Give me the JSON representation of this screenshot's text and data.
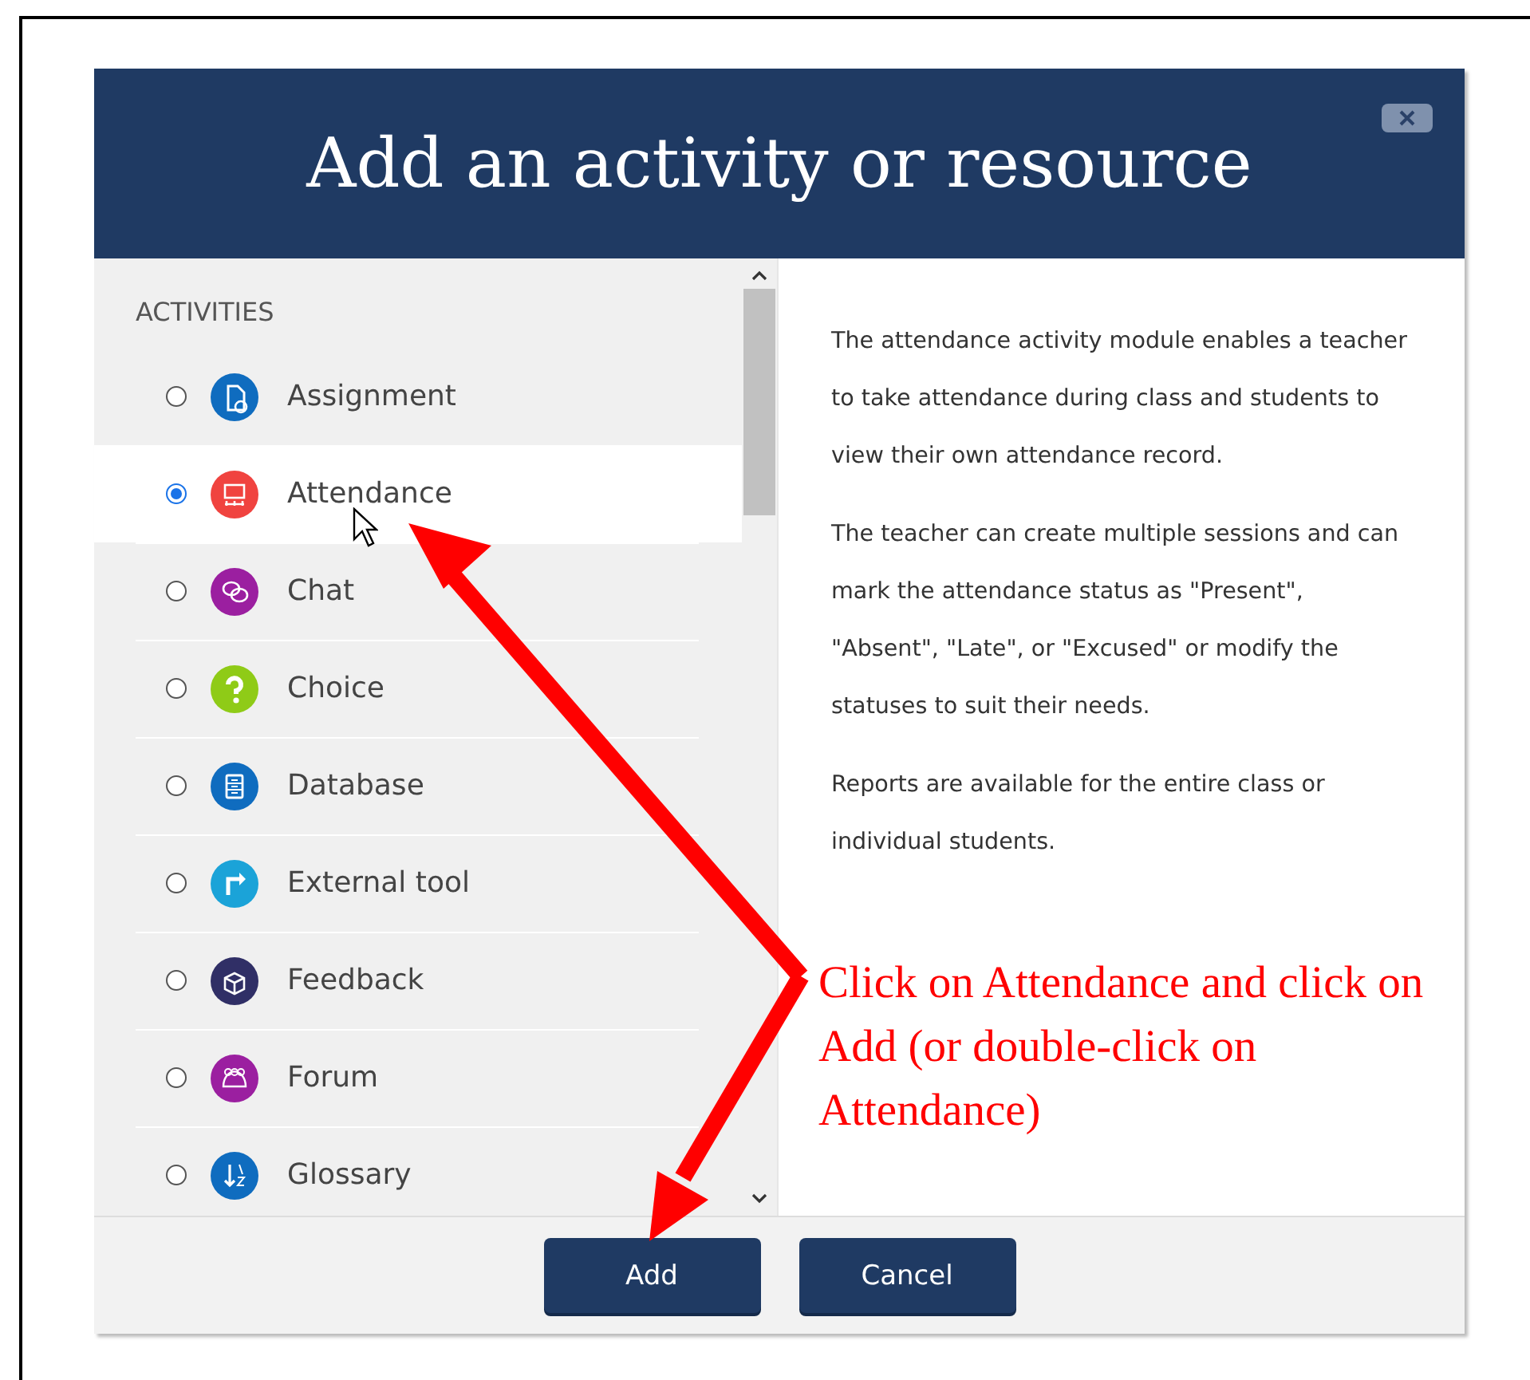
{
  "dialog": {
    "title": "Add an activity or resource",
    "section": "ACTIVITIES",
    "items": [
      {
        "label": "Assignment",
        "selected": false,
        "color": "#0f6cbf"
      },
      {
        "label": "Attendance",
        "selected": true,
        "color": "#f0433f"
      },
      {
        "label": "Chat",
        "selected": false,
        "color": "#9b1fa0"
      },
      {
        "label": "Choice",
        "selected": false,
        "color": "#8fcb17"
      },
      {
        "label": "Database",
        "selected": false,
        "color": "#0f6cbf"
      },
      {
        "label": "External tool",
        "selected": false,
        "color": "#1ba3d8"
      },
      {
        "label": "Feedback",
        "selected": false,
        "color": "#302f66"
      },
      {
        "label": "Forum",
        "selected": false,
        "color": "#9b1fa0"
      },
      {
        "label": "Glossary",
        "selected": false,
        "color": "#0f6cbf"
      }
    ],
    "description": [
      "The attendance activity module enables a teacher to take attendance during class and students to view their own attendance record.",
      "The teacher can create multiple sessions and can mark the attendance status as \"Present\", \"Absent\", \"Late\", or \"Excused\" or modify the statuses to suit their needs.",
      "Reports are available for the entire class or individual students."
    ],
    "buttons": [
      "Add",
      "Cancel"
    ]
  },
  "annotation": "Click on Attendance and click on Add (or double-click on Attendance)"
}
